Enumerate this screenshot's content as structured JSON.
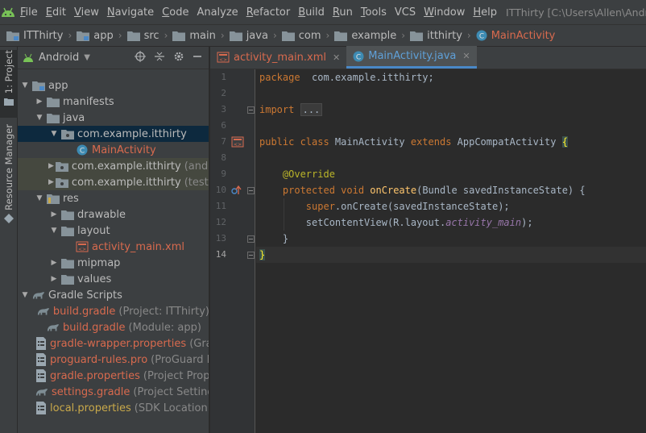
{
  "menu": {
    "items": [
      {
        "u": "F",
        "rest": "ile"
      },
      {
        "u": "E",
        "rest": "dit"
      },
      {
        "u": "V",
        "rest": "iew"
      },
      {
        "u": "N",
        "rest": "avigate"
      },
      {
        "u": "C",
        "rest": "ode"
      },
      {
        "u": "",
        "rest": "Analyze"
      },
      {
        "u": "R",
        "rest": "efactor"
      },
      {
        "u": "B",
        "rest": "uild"
      },
      {
        "u": "R",
        "rest": "un"
      },
      {
        "u": "T",
        "rest": "ools"
      },
      {
        "u": "",
        "rest": "VCS"
      },
      {
        "u": "W",
        "rest": "indow"
      },
      {
        "u": "H",
        "rest": "elp"
      }
    ],
    "window_title": "ITThirty [C:\\Users\\Allen\\AndroidS"
  },
  "breadcrumbs": [
    "ITThirty",
    "app",
    "src",
    "main",
    "java",
    "com",
    "example",
    "itthirty",
    "MainActivity"
  ],
  "side_tabs": {
    "project": "1: Project",
    "resource": "Resource Manager"
  },
  "project_panel": {
    "view_selector": "Android",
    "tree": [
      {
        "label": "app",
        "hint": "",
        "arrow": "▼",
        "depth": 0,
        "icon": "module-folder-icon",
        "style": ""
      },
      {
        "label": "manifests",
        "hint": "",
        "arrow": "▶",
        "depth": 1,
        "icon": "folder-icon",
        "style": ""
      },
      {
        "label": "java",
        "hint": "",
        "arrow": "▼",
        "depth": 1,
        "icon": "folder-icon",
        "style": ""
      },
      {
        "label": "com.example.itthirty",
        "hint": "",
        "arrow": "▼",
        "depth": 2,
        "icon": "package-icon",
        "style": "sel"
      },
      {
        "label": "MainActivity",
        "hint": "",
        "arrow": "",
        "depth": 3,
        "icon": "class-icon",
        "style": "red"
      },
      {
        "label": "com.example.itthirty",
        "hint": "(androidTest)",
        "arrow": "▶",
        "depth": 2,
        "icon": "package-icon",
        "style": "dim"
      },
      {
        "label": "com.example.itthirty",
        "hint": "(test)",
        "arrow": "▶",
        "depth": 2,
        "icon": "package-icon",
        "style": "dim"
      },
      {
        "label": "res",
        "hint": "",
        "arrow": "▼",
        "depth": 1,
        "icon": "res-folder-icon",
        "style": ""
      },
      {
        "label": "drawable",
        "hint": "",
        "arrow": "▶",
        "depth": 2,
        "icon": "folder-icon",
        "style": ""
      },
      {
        "label": "layout",
        "hint": "",
        "arrow": "▼",
        "depth": 2,
        "icon": "folder-icon",
        "style": ""
      },
      {
        "label": "activity_main.xml",
        "hint": "",
        "arrow": "",
        "depth": 3,
        "icon": "xml-layout-icon",
        "style": "red"
      },
      {
        "label": "mipmap",
        "hint": "",
        "arrow": "▶",
        "depth": 2,
        "icon": "folder-icon",
        "style": ""
      },
      {
        "label": "values",
        "hint": "",
        "arrow": "▶",
        "depth": 2,
        "icon": "folder-icon",
        "style": ""
      },
      {
        "label": "Gradle Scripts",
        "hint": "",
        "arrow": "▼",
        "depth": 0,
        "icon": "gradle-icon",
        "style": ""
      },
      {
        "label": "build.gradle",
        "hint": "(Project: ITThirty)",
        "arrow": "",
        "depth": 1,
        "icon": "gradle-icon",
        "style": "red"
      },
      {
        "label": "build.gradle",
        "hint": "(Module: app)",
        "arrow": "",
        "depth": 1,
        "icon": "gradle-icon",
        "style": "red"
      },
      {
        "label": "gradle-wrapper.properties",
        "hint": "(Gradle Version)",
        "arrow": "",
        "depth": 1,
        "icon": "properties-icon",
        "style": "red"
      },
      {
        "label": "proguard-rules.pro",
        "hint": "(ProGuard Rules for app)",
        "arrow": "",
        "depth": 1,
        "icon": "properties-icon",
        "style": "red"
      },
      {
        "label": "gradle.properties",
        "hint": "(Project Properties)",
        "arrow": "",
        "depth": 1,
        "icon": "properties-icon",
        "style": "red"
      },
      {
        "label": "settings.gradle",
        "hint": "(Project Settings)",
        "arrow": "",
        "depth": 1,
        "icon": "gradle-icon",
        "style": "red"
      },
      {
        "label": "local.properties",
        "hint": "(SDK Location)",
        "arrow": "",
        "depth": 1,
        "icon": "properties-icon",
        "style": "yellow"
      }
    ]
  },
  "editor": {
    "tabs": [
      {
        "label": "activity_main.xml",
        "icon": "xml-layout-icon",
        "active": false,
        "color": "red"
      },
      {
        "label": "MainActivity.java",
        "icon": "class-icon",
        "active": true,
        "color": "blue"
      }
    ],
    "current_line": 14,
    "lines": [
      {
        "n": "1",
        "tokens": [
          [
            "kw",
            "package"
          ],
          [
            "",
            "  com.example.itthirty;"
          ]
        ]
      },
      {
        "n": "2",
        "tokens": []
      },
      {
        "n": "3",
        "tokens": [
          [
            "kw",
            "import"
          ],
          [
            "",
            " "
          ],
          [
            "fold",
            "..."
          ]
        ]
      },
      {
        "n": "6",
        "tokens": []
      },
      {
        "n": "7",
        "tokens": [
          [
            "kw",
            "public class"
          ],
          [
            "",
            " MainActivity "
          ],
          [
            "kw",
            "extends"
          ],
          [
            "",
            " AppCompatActivity "
          ],
          [
            "brace-hl",
            "{"
          ]
        ]
      },
      {
        "n": "8",
        "tokens": []
      },
      {
        "n": "9",
        "tokens": [
          [
            "",
            "    "
          ],
          [
            "ann",
            "@Override"
          ]
        ]
      },
      {
        "n": "10",
        "tokens": [
          [
            "",
            "    "
          ],
          [
            "kw",
            "protected void"
          ],
          [
            "",
            " "
          ],
          [
            "fn",
            "onCreate"
          ],
          [
            "",
            "(Bundle savedInstanceState) {"
          ]
        ]
      },
      {
        "n": "11",
        "tokens": [
          [
            "",
            "        "
          ],
          [
            "kw",
            "super"
          ],
          [
            "",
            ".onCreate(savedInstanceState);"
          ]
        ]
      },
      {
        "n": "12",
        "tokens": [
          [
            "",
            "        setContentView(R.layout."
          ],
          [
            "it",
            "activity_main"
          ],
          [
            "",
            ");"
          ]
        ]
      },
      {
        "n": "13",
        "tokens": [
          [
            "",
            "    }"
          ]
        ]
      },
      {
        "n": "14",
        "tokens": [
          [
            "brace-hl",
            "}"
          ]
        ]
      }
    ]
  }
}
